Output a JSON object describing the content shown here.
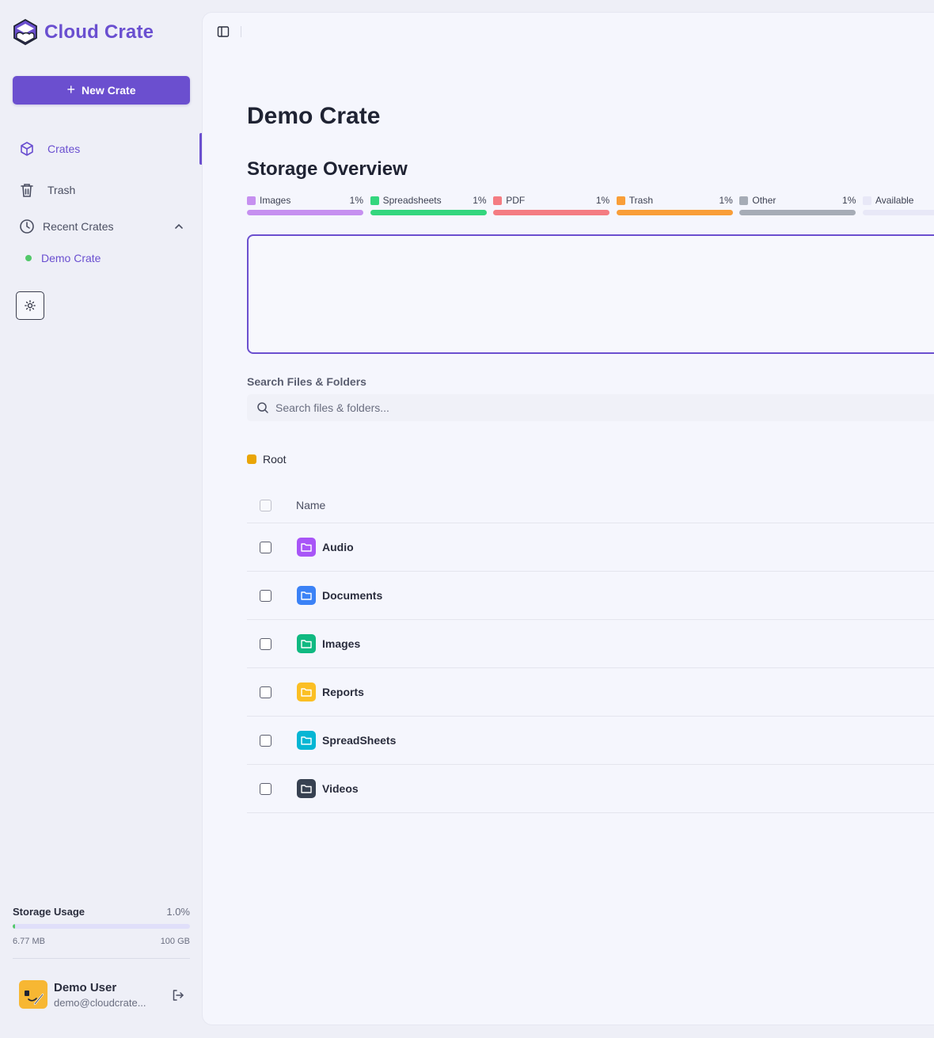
{
  "brand": {
    "name": "Cloud Crate",
    "color": "#6a4fd0"
  },
  "sidebar": {
    "new_button": "New Crate",
    "nav": [
      {
        "label": "Crates",
        "icon": "box-icon",
        "active": true
      },
      {
        "label": "Trash",
        "icon": "trash-icon",
        "active": false
      }
    ],
    "recent": {
      "label": "Recent Crates",
      "items": [
        {
          "label": "Demo Crate"
        }
      ]
    }
  },
  "storage": {
    "title": "Storage Usage",
    "percent": "1.0%",
    "used": "6.77 MB",
    "total": "100 GB",
    "fill_fraction": 0.01
  },
  "user": {
    "name": "Demo User",
    "email": "demo@cloudcrate..."
  },
  "main": {
    "title": "Demo Crate",
    "overview_title": "Storage Overview",
    "legend": [
      {
        "label": "Images",
        "pct": "1%",
        "color": "#c690f0"
      },
      {
        "label": "Spreadsheets",
        "pct": "1%",
        "color": "#34d67e"
      },
      {
        "label": "PDF",
        "pct": "1%",
        "color": "#f47c82"
      },
      {
        "label": "Trash",
        "pct": "1%",
        "color": "#f99e38"
      },
      {
        "label": "Other",
        "pct": "1%",
        "color": "#a6acb6"
      },
      {
        "label": "Available",
        "pct": "",
        "color": "#e8e8f7"
      }
    ],
    "search": {
      "label": "Search Files & Folders",
      "placeholder": "Search files & folders..."
    },
    "breadcrumb": "Root",
    "table": {
      "header": "Name",
      "rows": [
        {
          "name": "Audio",
          "color": "#a855f7"
        },
        {
          "name": "Documents",
          "color": "#3b82f6"
        },
        {
          "name": "Images",
          "color": "#10b981"
        },
        {
          "name": "Reports",
          "color": "#fbbf24"
        },
        {
          "name": "SpreadSheets",
          "color": "#06b6d4"
        },
        {
          "name": "Videos",
          "color": "#374151"
        }
      ]
    }
  }
}
